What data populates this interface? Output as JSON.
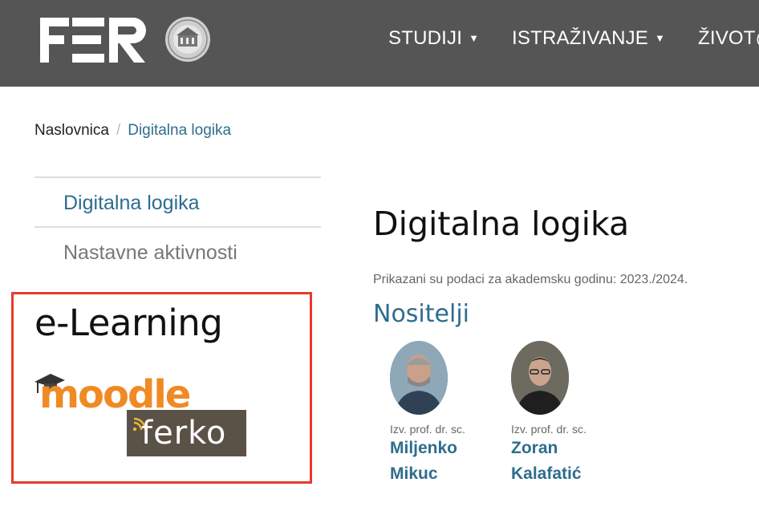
{
  "header": {
    "logo_alt": "FER",
    "nav": [
      {
        "label": "STUDIJI",
        "has_dropdown": true
      },
      {
        "label": "ISTRAŽIVANJE",
        "has_dropdown": true
      },
      {
        "label": "ŽIVOT@",
        "has_dropdown": false
      }
    ]
  },
  "breadcrumb": {
    "home": "Naslovnica",
    "separator": "/",
    "current": "Digitalna logika"
  },
  "sidebar": {
    "items": [
      {
        "label": "Digitalna logika",
        "active": true
      },
      {
        "label": "Nastavne aktivnosti",
        "active": false
      }
    ]
  },
  "elearning": {
    "title": "e-Learning",
    "links": [
      {
        "name": "moodle",
        "label": "moodle"
      },
      {
        "name": "ferko",
        "label": "ferko"
      }
    ]
  },
  "main": {
    "title": "Digitalna logika",
    "year_note": "Prikazani su podaci za akademsku godinu: 2023./2024.",
    "section_title": "Nositelji",
    "lecturers": [
      {
        "title": "Izv. prof. dr. sc.",
        "first_name": "Miljenko",
        "last_name": "Mikuc"
      },
      {
        "title": "Izv. prof. dr. sc.",
        "first_name": "Zoran",
        "last_name": "Kalafatić"
      }
    ]
  },
  "colors": {
    "header_bg": "#555555",
    "link": "#2e6d8e",
    "highlight_border": "#e53a2f",
    "moodle_orange": "#f08a24",
    "ferko_bg": "#5a5247"
  }
}
